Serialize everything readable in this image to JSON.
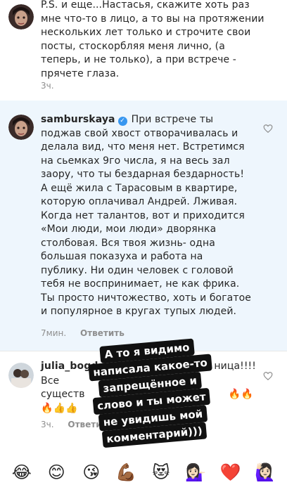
{
  "comments": [
    {
      "text": "P.S. и еще...Настасья, скажите хоть раз мне что-то в лицо, а то вы на протяжении нескольких лет только и строчите свои посты, стоскорбляя меня лично, (а теперь, и не только), а при встрече - прячете глаза.",
      "time": "3ч."
    },
    {
      "username": "samburskaya",
      "text": "При встрече ты поджав свой хвост отворачивалась и делала вид, что меня нет. Встретимся на сьемках 9го числа, я на весь зал заору, что ты бездарная бездарность! А ещё жила с Тарасовым в квартире, которую оплачивал Андрей. Лживая. Когда нет талантов, вот и приходится «Мои люди, мои люди» дворянка столбовая. Вся твоя жизнь- одна большая показуха и работа на публику. Ни один человек с головой тебя не воспринимает, не как фрика. Ты просто ничтожество, хоть и богатое и популярное в кругах тупых людей.",
      "time": "7мин.",
      "reply": "Ответить"
    },
    {
      "username": "julia_bogda",
      "text_line1": "ница!!!!",
      "text_line2": "Все",
      "text_line3": "существ",
      "emojis_line": "🔥🔥",
      "emojis_line2": "🔥👍👍",
      "time": "3ч.",
      "reply": "Ответить"
    }
  ],
  "sticker": {
    "lines": [
      "А то я видимо",
      "написала какое-то",
      "запрещённое и",
      "слово и ты может",
      "не увидишь мой",
      "комментарий)))"
    ]
  },
  "emoji_bar": [
    "😂",
    "😊",
    "😘",
    "💪🏾",
    "😻",
    "💁🏻‍♀️",
    "❤️",
    "🙋🏻‍♀️"
  ],
  "colors": {
    "highlight_bg": "#eef6fd",
    "verified_blue": "#3897f0",
    "meta_gray": "#8e8e8e"
  }
}
